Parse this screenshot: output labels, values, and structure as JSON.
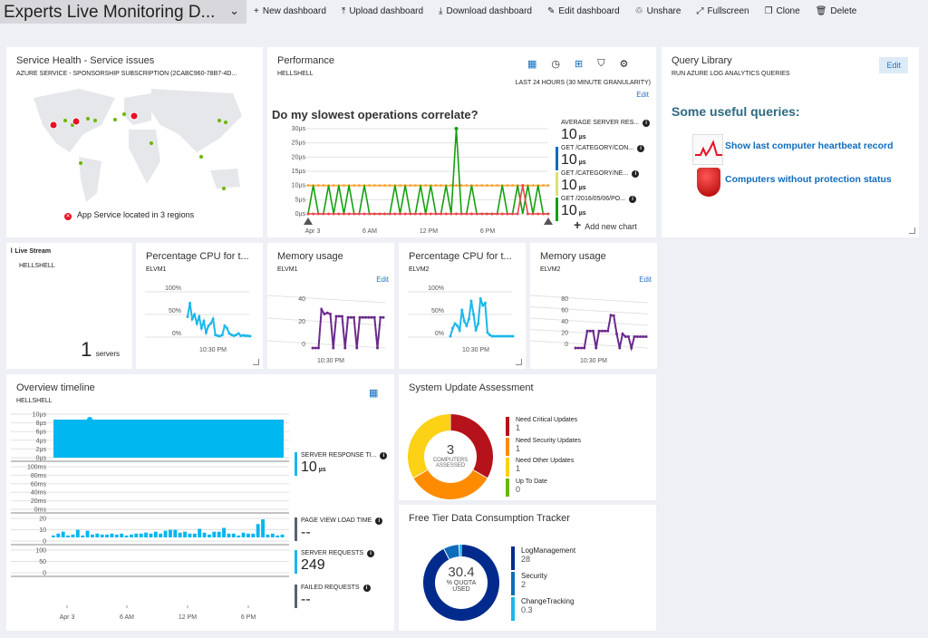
{
  "header": {
    "title": "Experts Live Monitoring D...",
    "commands": [
      {
        "icon": "plus-icon",
        "glyph": "+",
        "label": "New dashboard"
      },
      {
        "icon": "upload-icon",
        "glyph": "⤒",
        "label": "Upload dashboard"
      },
      {
        "icon": "download-icon",
        "glyph": "⤓",
        "label": "Download dashboard"
      },
      {
        "icon": "pencil-icon",
        "glyph": "✎",
        "label": "Edit dashboard"
      },
      {
        "icon": "unshare-icon",
        "glyph": "♲",
        "label": "Unshare"
      },
      {
        "icon": "fullscreen-icon",
        "glyph": "⤢",
        "label": "Fullscreen"
      },
      {
        "icon": "clone-icon",
        "glyph": "❐",
        "label": "Clone"
      },
      {
        "icon": "trash-icon",
        "glyph": "🗑",
        "label": "Delete"
      }
    ]
  },
  "service_health": {
    "title": "Service Health - Service issues",
    "subtitle": "AZURE SERVICE - SPONSORSHIP SUBSCRIPTION (2CABC960-78B7-4D...",
    "status": "App Service located in 3 regions"
  },
  "performance": {
    "title": "Performance",
    "subtitle": "HELLSHELL",
    "range": "LAST 24 HOURS (30 MINUTE GRANULARITY)",
    "edit": "Edit",
    "add_chart": "Add new chart",
    "legend": [
      {
        "label": "AVERAGE SERVER RES...",
        "value": "10",
        "unit": "µs",
        "color": "#ffffff"
      },
      {
        "label": "GET /CATEGORY/CON...",
        "value": "10",
        "unit": "µs",
        "color": "#0f6cbd"
      },
      {
        "label": "GET /CATEGORY/NE...",
        "value": "10",
        "unit": "µs",
        "color": "#dbe36b"
      },
      {
        "label": "GET /2016/05/06/PO...",
        "value": "10",
        "unit": "µs",
        "color": "#13a10e"
      }
    ]
  },
  "query_library": {
    "title": "Query Library",
    "subtitle": "RUN AZURE LOG ANALYTICS QUERIES",
    "edit": "Edit",
    "heading": "Some useful queries:",
    "links": [
      "Show last computer heartbeat record",
      "Computers without protection status"
    ]
  },
  "live_stream": {
    "title": "Live Stream",
    "subtitle": "HELLSHELL",
    "count": "1",
    "unit": "servers"
  },
  "small_tiles": [
    {
      "title": "Percentage CPU for t...",
      "subtitle": "ELVM1",
      "edit": "",
      "color": "#1ab8ea",
      "yticks": [
        "100%",
        "50%",
        "0%"
      ],
      "x": "10:30 PM"
    },
    {
      "title": "Memory usage",
      "subtitle": "ELVM1",
      "edit": "Edit",
      "color": "#6b2a8c",
      "yticks": [
        "40",
        "20",
        "0"
      ],
      "x": "10:30 PM"
    },
    {
      "title": "Percentage CPU for t...",
      "subtitle": "ELVM2",
      "edit": "",
      "color": "#1ab8ea",
      "yticks": [
        "100%",
        "50%",
        "0%"
      ],
      "x": "10:30 PM"
    },
    {
      "title": "Memory usage",
      "subtitle": "ELVM2",
      "edit": "Edit",
      "color": "#6b2a8c",
      "yticks": [
        "80",
        "60",
        "40",
        "20",
        "0"
      ],
      "x": "10:30 PM"
    }
  ],
  "overview": {
    "title": "Overview timeline",
    "subtitle": "HELLSHELL",
    "metrics": [
      {
        "label": "SERVER RESPONSE TI...",
        "value": "10",
        "unit": "µs",
        "color": "#1ab8ea"
      },
      {
        "label": "PAGE VIEW LOAD TIME",
        "value": "--",
        "unit": "",
        "color": "#5a6270"
      },
      {
        "label": "SERVER REQUESTS",
        "value": "249",
        "unit": "",
        "color": "#1ab8ea"
      },
      {
        "label": "FAILED REQUESTS",
        "value": "--",
        "unit": "",
        "color": "#5a6270"
      }
    ]
  },
  "update_assessment": {
    "title": "System Update Assessment",
    "center_value": "3",
    "center_label": "COMPUTERS ASSESSED",
    "items": [
      {
        "label": "Need Critical Updates",
        "value": 1,
        "color": "#b5121b"
      },
      {
        "label": "Need Security Updates",
        "value": 1,
        "color": "#ff8c00"
      },
      {
        "label": "Need Other Updates",
        "value": 1,
        "color": "#fcd116"
      },
      {
        "label": "Up To Date",
        "value": 0,
        "color": "#6bb700"
      }
    ]
  },
  "data_tracker": {
    "title": "Free Tier Data Consumption Tracker",
    "center_value": "30.4",
    "center_label": "% QUOTA USED",
    "items": [
      {
        "label": "LogManagement",
        "value": 28,
        "color": "#002b8c"
      },
      {
        "label": "Security",
        "value": 2,
        "color": "#0f6cbd"
      },
      {
        "label": "ChangeTracking",
        "value": 0.3,
        "color": "#1ab8ea"
      }
    ]
  },
  "chart_data": [
    {
      "type": "line",
      "title": "Do my slowest operations correlate?",
      "yticks": [
        "30µs",
        "25µs",
        "20µs",
        "15µs",
        "10µs",
        "5µs",
        "0µs"
      ],
      "ylim": [
        0,
        30
      ],
      "xticks": [
        "Apr 3",
        "6 AM",
        "12 PM",
        "6 PM"
      ],
      "series": [
        {
          "color": "#f7a93b",
          "values": [
            10,
            10,
            10,
            10,
            10,
            10,
            10,
            10,
            10,
            10,
            10,
            10,
            10,
            10,
            10,
            10,
            10,
            10,
            10,
            10,
            10,
            10,
            10,
            10,
            10,
            10,
            10,
            10,
            10,
            10,
            10,
            10,
            10,
            10,
            10,
            10,
            10,
            10,
            10,
            10,
            10,
            10,
            10,
            10,
            10,
            10,
            10,
            10
          ]
        },
        {
          "color": "#13a10e",
          "values": [
            0,
            10,
            0,
            0,
            10,
            0,
            10,
            0,
            10,
            0,
            0,
            10,
            0,
            0,
            0,
            0,
            0,
            10,
            0,
            10,
            0,
            0,
            10,
            0,
            10,
            0,
            0,
            10,
            0,
            30,
            0,
            0,
            10,
            0,
            0,
            0,
            0,
            0,
            10,
            0,
            0,
            10,
            0,
            10,
            0,
            10,
            0,
            0
          ]
        },
        {
          "color": "#e8464f",
          "values": [
            0,
            0,
            0,
            0,
            0,
            0,
            0,
            0,
            0,
            0,
            0,
            0,
            0,
            0,
            0,
            0,
            0,
            0,
            0,
            0,
            0,
            0,
            0,
            0,
            0,
            0,
            0,
            0,
            0,
            0,
            0,
            0,
            0,
            0,
            0,
            0,
            0,
            0,
            0,
            0,
            0,
            0,
            10,
            0,
            0,
            0,
            0,
            0
          ]
        }
      ]
    },
    {
      "type": "area",
      "name": "server-response",
      "yticks": [
        "10µs",
        "8µs",
        "6µs",
        "4µs",
        "2µs",
        "0µs"
      ],
      "ylim": [
        0,
        10
      ],
      "value": 10
    },
    {
      "type": "line",
      "name": "page-view-load",
      "yticks": [
        "100ms",
        "80ms",
        "60ms",
        "40ms",
        "20ms",
        "0ms"
      ],
      "ylim": [
        0,
        100
      ]
    },
    {
      "type": "bar",
      "name": "server-requests",
      "yticks": [
        "20",
        "10",
        "0"
      ],
      "ylim": [
        0,
        20
      ],
      "values": [
        2,
        4,
        6,
        2,
        3,
        8,
        2,
        7,
        3,
        4,
        3,
        3,
        4,
        3,
        4,
        2,
        3,
        4,
        4,
        5,
        4,
        6,
        4,
        7,
        8,
        8,
        5,
        6,
        4,
        4,
        9,
        5,
        3,
        6,
        6,
        10,
        4,
        4,
        2,
        5,
        4,
        4,
        14,
        19,
        3,
        4,
        2,
        3
      ]
    },
    {
      "type": "line",
      "name": "failed-requests",
      "yticks": [
        "100",
        "50",
        "0"
      ],
      "ylim": [
        0,
        100
      ],
      "xticks": [
        "Apr 3",
        "6 AM",
        "12 PM",
        "6 PM"
      ]
    }
  ]
}
